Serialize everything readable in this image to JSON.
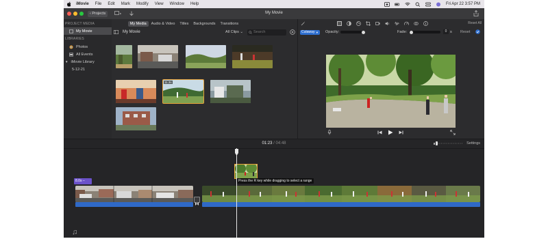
{
  "menubar": {
    "items": [
      "iMovie",
      "File",
      "Edit",
      "Mark",
      "Modify",
      "View",
      "Window",
      "Help"
    ],
    "datetime": "Fri Apr 22  3:57 PM"
  },
  "toolbar": {
    "projects_label": "Projects",
    "window_title": "My Movie"
  },
  "libraries_sidebar": {
    "project_media_header": "PROJECT MEDIA",
    "project_item": "My Movie",
    "libraries_header": "LIBRARIES",
    "items": [
      "Photos",
      "All Events",
      "iMovie Library",
      "5-12-21"
    ]
  },
  "browser": {
    "tabs": [
      "My Media",
      "Audio & Video",
      "Titles",
      "Backgrounds",
      "Transitions"
    ],
    "selected_tab": "My Media",
    "title": "My Movie",
    "filter": "All Clips",
    "search_placeholder": "Search",
    "clip_durations": [
      "11.3s"
    ]
  },
  "inspector": {
    "reset_all": "Reset All",
    "overlay_mode": "Cutaway",
    "opacity_label": "Opacity:",
    "fade_label": "Fade:",
    "fade_value": "0",
    "fade_unit": "s",
    "reset_label": "Reset"
  },
  "timeline": {
    "current_time": "01:23",
    "separator": "/",
    "total_time": "04:48",
    "settings_label": "Settings",
    "title_clip_label": "8.0s –",
    "tooltip": "Press the R key while dragging to select a range"
  },
  "colors": {
    "accent": "#2e6fd0",
    "selection": "#e8a33a",
    "audio": "#2f69c7",
    "title_clip": "#6b52c9"
  }
}
